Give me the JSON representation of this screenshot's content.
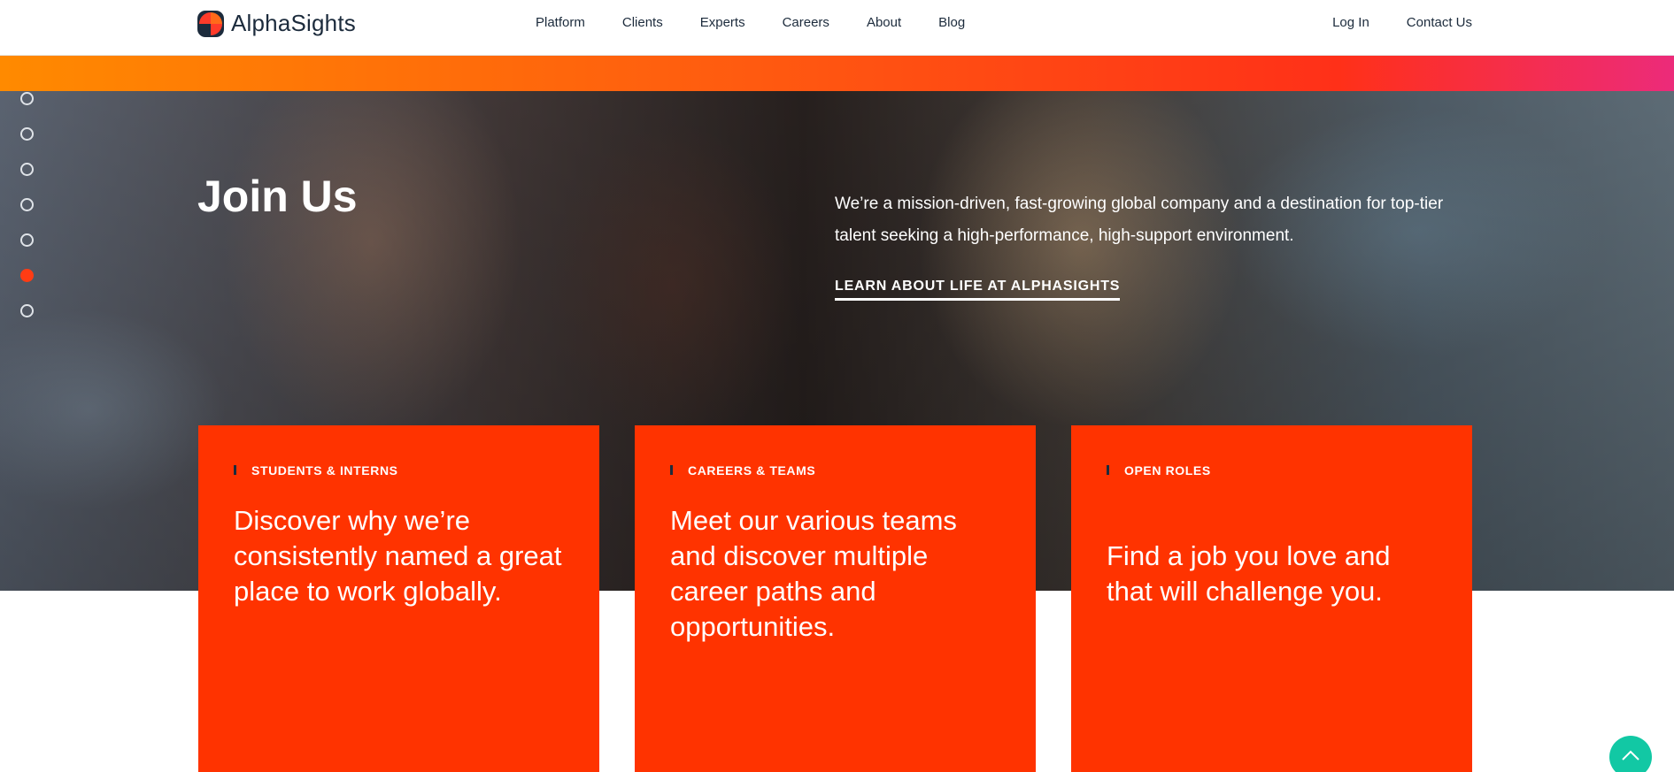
{
  "header": {
    "logo_text": "AlphaSights",
    "nav": [
      "Platform",
      "Clients",
      "Experts",
      "Careers",
      "About",
      "Blog"
    ],
    "login_label": "Log In",
    "contact_label": "Contact Us"
  },
  "hero": {
    "title": "Join Us",
    "description": "We’re a mission-driven, fast-growing global company and a destination for top-tier talent seeking a high-performance, high-support environment.",
    "link_label": "LEARN ABOUT LIFE AT ALPHASIGHTS"
  },
  "slides": {
    "count": 7,
    "active_index": 5
  },
  "cards": [
    {
      "label": "STUDENTS & INTERNS",
      "text": "Discover why we’re consistently named a great place to work globally."
    },
    {
      "label": "CAREERS & TEAMS",
      "text": "Meet our various teams and discover multiple career paths and opportunities."
    },
    {
      "label": "OPEN ROLES",
      "text": "Find a job you love and that will challenge you."
    }
  ],
  "colors": {
    "accent": "#ff3300",
    "scroll_top": "#12c8a4",
    "text_dark": "#1c2b3c"
  },
  "icons": {
    "scroll_top": "chevron-up-icon",
    "logo": "alphasights-logo-icon"
  }
}
